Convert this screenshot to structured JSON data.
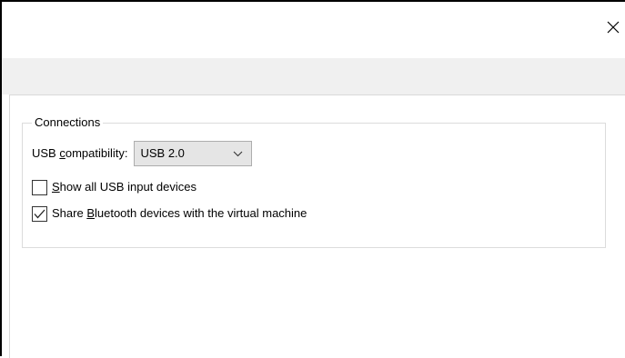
{
  "window": {
    "close_icon": "close-icon"
  },
  "connections": {
    "legend": "Connections",
    "usb_compat": {
      "label_pre": "USB ",
      "label_accel": "c",
      "label_post": "ompatibility:",
      "selected": "USB 2.0",
      "dropdown_icon": "chevron-down-icon"
    },
    "show_all_usb": {
      "checked": false,
      "accel": "S",
      "label_post": "how all USB input devices"
    },
    "share_bluetooth": {
      "checked": true,
      "label_pre": "Share ",
      "accel": "B",
      "label_post": "luetooth devices with the virtual machine",
      "check_icon": "checkmark-icon"
    }
  }
}
